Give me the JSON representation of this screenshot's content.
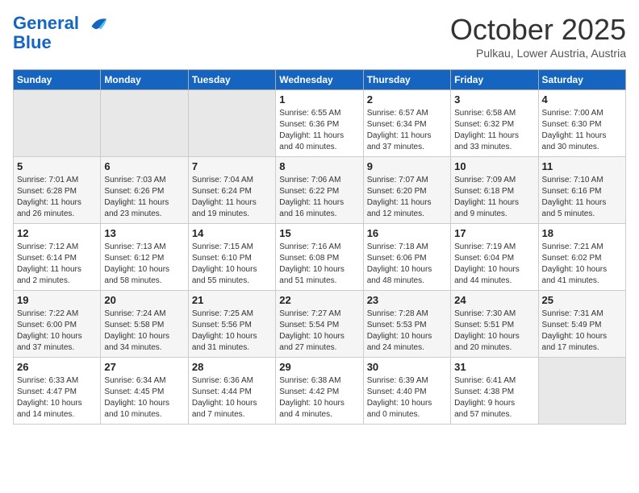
{
  "header": {
    "logo_line1": "General",
    "logo_line2": "Blue",
    "month": "October 2025",
    "location": "Pulkau, Lower Austria, Austria"
  },
  "days_of_week": [
    "Sunday",
    "Monday",
    "Tuesday",
    "Wednesday",
    "Thursday",
    "Friday",
    "Saturday"
  ],
  "weeks": [
    [
      {
        "day": "",
        "info": ""
      },
      {
        "day": "",
        "info": ""
      },
      {
        "day": "",
        "info": ""
      },
      {
        "day": "1",
        "info": "Sunrise: 6:55 AM\nSunset: 6:36 PM\nDaylight: 11 hours\nand 40 minutes."
      },
      {
        "day": "2",
        "info": "Sunrise: 6:57 AM\nSunset: 6:34 PM\nDaylight: 11 hours\nand 37 minutes."
      },
      {
        "day": "3",
        "info": "Sunrise: 6:58 AM\nSunset: 6:32 PM\nDaylight: 11 hours\nand 33 minutes."
      },
      {
        "day": "4",
        "info": "Sunrise: 7:00 AM\nSunset: 6:30 PM\nDaylight: 11 hours\nand 30 minutes."
      }
    ],
    [
      {
        "day": "5",
        "info": "Sunrise: 7:01 AM\nSunset: 6:28 PM\nDaylight: 11 hours\nand 26 minutes."
      },
      {
        "day": "6",
        "info": "Sunrise: 7:03 AM\nSunset: 6:26 PM\nDaylight: 11 hours\nand 23 minutes."
      },
      {
        "day": "7",
        "info": "Sunrise: 7:04 AM\nSunset: 6:24 PM\nDaylight: 11 hours\nand 19 minutes."
      },
      {
        "day": "8",
        "info": "Sunrise: 7:06 AM\nSunset: 6:22 PM\nDaylight: 11 hours\nand 16 minutes."
      },
      {
        "day": "9",
        "info": "Sunrise: 7:07 AM\nSunset: 6:20 PM\nDaylight: 11 hours\nand 12 minutes."
      },
      {
        "day": "10",
        "info": "Sunrise: 7:09 AM\nSunset: 6:18 PM\nDaylight: 11 hours\nand 9 minutes."
      },
      {
        "day": "11",
        "info": "Sunrise: 7:10 AM\nSunset: 6:16 PM\nDaylight: 11 hours\nand 5 minutes."
      }
    ],
    [
      {
        "day": "12",
        "info": "Sunrise: 7:12 AM\nSunset: 6:14 PM\nDaylight: 11 hours\nand 2 minutes."
      },
      {
        "day": "13",
        "info": "Sunrise: 7:13 AM\nSunset: 6:12 PM\nDaylight: 10 hours\nand 58 minutes."
      },
      {
        "day": "14",
        "info": "Sunrise: 7:15 AM\nSunset: 6:10 PM\nDaylight: 10 hours\nand 55 minutes."
      },
      {
        "day": "15",
        "info": "Sunrise: 7:16 AM\nSunset: 6:08 PM\nDaylight: 10 hours\nand 51 minutes."
      },
      {
        "day": "16",
        "info": "Sunrise: 7:18 AM\nSunset: 6:06 PM\nDaylight: 10 hours\nand 48 minutes."
      },
      {
        "day": "17",
        "info": "Sunrise: 7:19 AM\nSunset: 6:04 PM\nDaylight: 10 hours\nand 44 minutes."
      },
      {
        "day": "18",
        "info": "Sunrise: 7:21 AM\nSunset: 6:02 PM\nDaylight: 10 hours\nand 41 minutes."
      }
    ],
    [
      {
        "day": "19",
        "info": "Sunrise: 7:22 AM\nSunset: 6:00 PM\nDaylight: 10 hours\nand 37 minutes."
      },
      {
        "day": "20",
        "info": "Sunrise: 7:24 AM\nSunset: 5:58 PM\nDaylight: 10 hours\nand 34 minutes."
      },
      {
        "day": "21",
        "info": "Sunrise: 7:25 AM\nSunset: 5:56 PM\nDaylight: 10 hours\nand 31 minutes."
      },
      {
        "day": "22",
        "info": "Sunrise: 7:27 AM\nSunset: 5:54 PM\nDaylight: 10 hours\nand 27 minutes."
      },
      {
        "day": "23",
        "info": "Sunrise: 7:28 AM\nSunset: 5:53 PM\nDaylight: 10 hours\nand 24 minutes."
      },
      {
        "day": "24",
        "info": "Sunrise: 7:30 AM\nSunset: 5:51 PM\nDaylight: 10 hours\nand 20 minutes."
      },
      {
        "day": "25",
        "info": "Sunrise: 7:31 AM\nSunset: 5:49 PM\nDaylight: 10 hours\nand 17 minutes."
      }
    ],
    [
      {
        "day": "26",
        "info": "Sunrise: 6:33 AM\nSunset: 4:47 PM\nDaylight: 10 hours\nand 14 minutes."
      },
      {
        "day": "27",
        "info": "Sunrise: 6:34 AM\nSunset: 4:45 PM\nDaylight: 10 hours\nand 10 minutes."
      },
      {
        "day": "28",
        "info": "Sunrise: 6:36 AM\nSunset: 4:44 PM\nDaylight: 10 hours\nand 7 minutes."
      },
      {
        "day": "29",
        "info": "Sunrise: 6:38 AM\nSunset: 4:42 PM\nDaylight: 10 hours\nand 4 minutes."
      },
      {
        "day": "30",
        "info": "Sunrise: 6:39 AM\nSunset: 4:40 PM\nDaylight: 10 hours\nand 0 minutes."
      },
      {
        "day": "31",
        "info": "Sunrise: 6:41 AM\nSunset: 4:38 PM\nDaylight: 9 hours\nand 57 minutes."
      },
      {
        "day": "",
        "info": ""
      }
    ]
  ]
}
